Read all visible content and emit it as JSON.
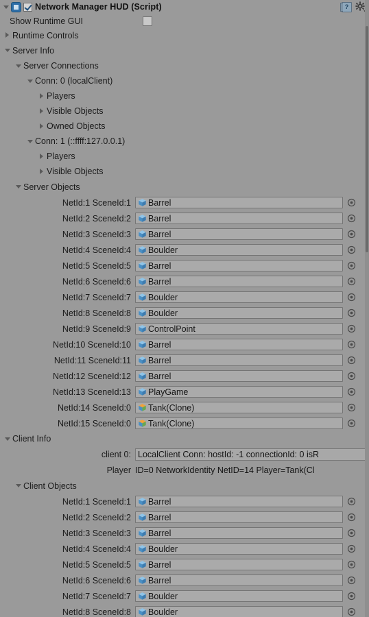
{
  "component": {
    "title": "Network Manager HUD (Script)",
    "enabled": true,
    "expanded": true,
    "script_icon": "script-icon",
    "help_icon": "help-icon",
    "help_glyph": "?",
    "gear_icon": "gear-icon"
  },
  "properties": {
    "show_runtime_gui": {
      "label": "Show Runtime GUI",
      "checked": false
    },
    "runtime_controls": {
      "label": "Runtime Controls",
      "expanded": false
    }
  },
  "server_info": {
    "label": "Server Info",
    "expanded": true,
    "server_connections": {
      "label": "Server Connections",
      "expanded": true,
      "connections": [
        {
          "label": "Conn: 0 (localClient)",
          "expanded": true,
          "children": [
            {
              "label": "Players",
              "expanded": false
            },
            {
              "label": "Visible Objects",
              "expanded": false
            },
            {
              "label": "Owned Objects",
              "expanded": false
            }
          ]
        },
        {
          "label": "Conn: 1 (::ffff:127.0.0.1)",
          "expanded": true,
          "children": [
            {
              "label": "Players",
              "expanded": false
            },
            {
              "label": "Visible Objects",
              "expanded": false
            }
          ]
        }
      ]
    },
    "server_objects": {
      "label": "Server Objects",
      "expanded": true,
      "rows": [
        {
          "label": "NetId:1 SceneId:1",
          "value": "Barrel",
          "icon": "scene-cube-icon"
        },
        {
          "label": "NetId:2 SceneId:2",
          "value": "Barrel",
          "icon": "scene-cube-icon"
        },
        {
          "label": "NetId:3 SceneId:3",
          "value": "Barrel",
          "icon": "scene-cube-icon"
        },
        {
          "label": "NetId:4 SceneId:4",
          "value": "Boulder",
          "icon": "scene-cube-icon"
        },
        {
          "label": "NetId:5 SceneId:5",
          "value": "Barrel",
          "icon": "scene-cube-icon"
        },
        {
          "label": "NetId:6 SceneId:6",
          "value": "Barrel",
          "icon": "scene-cube-icon"
        },
        {
          "label": "NetId:7 SceneId:7",
          "value": "Boulder",
          "icon": "scene-cube-icon"
        },
        {
          "label": "NetId:8 SceneId:8",
          "value": "Boulder",
          "icon": "scene-cube-icon"
        },
        {
          "label": "NetId:9 SceneId:9",
          "value": "ControlPoint",
          "icon": "scene-cube-icon"
        },
        {
          "label": "NetId:10 SceneId:10",
          "value": "Barrel",
          "icon": "scene-cube-icon"
        },
        {
          "label": "NetId:11 SceneId:11",
          "value": "Barrel",
          "icon": "scene-cube-icon"
        },
        {
          "label": "NetId:12 SceneId:12",
          "value": "Barrel",
          "icon": "scene-cube-icon"
        },
        {
          "label": "NetId:13 SceneId:13",
          "value": "PlayGame",
          "icon": "scene-cube-icon"
        },
        {
          "label": "NetId:14 SceneId:0",
          "value": "Tank(Clone)",
          "icon": "prefab-cube-icon"
        },
        {
          "label": "NetId:15 SceneId:0",
          "value": "Tank(Clone)",
          "icon": "prefab-cube-icon"
        }
      ]
    }
  },
  "client_info": {
    "label": "Client Info",
    "expanded": true,
    "client_0": {
      "label": "client 0:",
      "value": "LocalClient Conn: hostId: -1 connectionId: 0 isR"
    },
    "player": {
      "label": "Player",
      "value": "ID=0 NetworkIdentity NetID=14 Player=Tank(Cl"
    },
    "client_objects": {
      "label": "Client Objects",
      "expanded": true,
      "rows": [
        {
          "label": "NetId:1 SceneId:1",
          "value": "Barrel",
          "icon": "scene-cube-icon"
        },
        {
          "label": "NetId:2 SceneId:2",
          "value": "Barrel",
          "icon": "scene-cube-icon"
        },
        {
          "label": "NetId:3 SceneId:3",
          "value": "Barrel",
          "icon": "scene-cube-icon"
        },
        {
          "label": "NetId:4 SceneId:4",
          "value": "Boulder",
          "icon": "scene-cube-icon"
        },
        {
          "label": "NetId:5 SceneId:5",
          "value": "Barrel",
          "icon": "scene-cube-icon"
        },
        {
          "label": "NetId:6 SceneId:6",
          "value": "Barrel",
          "icon": "scene-cube-icon"
        },
        {
          "label": "NetId:7 SceneId:7",
          "value": "Boulder",
          "icon": "scene-cube-icon"
        },
        {
          "label": "NetId:8 SceneId:8",
          "value": "Boulder",
          "icon": "scene-cube-icon"
        }
      ]
    }
  },
  "colors": {
    "background": "#9a9a9a",
    "field_bg": "#aaaaaa",
    "field_border": "#747474",
    "accent_blue": "#2f6fa8",
    "text": "#1b1b1b"
  },
  "scrollbar": {
    "visible": true
  }
}
